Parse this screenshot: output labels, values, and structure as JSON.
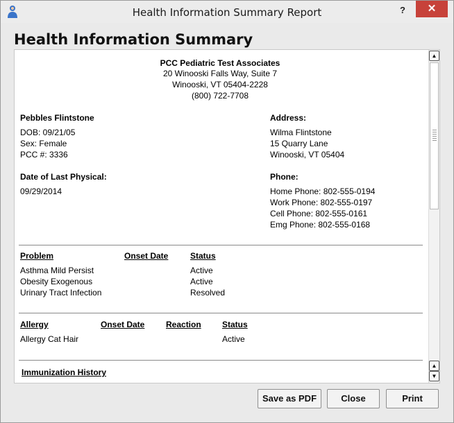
{
  "window": {
    "title": "Health Information Summary Report",
    "help_label": "?",
    "close_label": "✕"
  },
  "heading": "Health Information Summary",
  "practice": {
    "name": "PCC Pediatric Test Associates",
    "address1": "20 Winooski Falls Way, Suite 7",
    "address2": "Winooski, VT 05404-2228",
    "phone": "(800) 722-7708"
  },
  "patient": {
    "name": "Pebbles Flintstone",
    "dob": "DOB: 09/21/05",
    "sex": "Sex: Female",
    "pcc": "PCC #: 3336",
    "last_physical_label": "Date of Last Physical:",
    "last_physical": "09/29/2014"
  },
  "address": {
    "label": "Address:",
    "line1": "Wilma Flintstone",
    "line2": "15 Quarry Lane",
    "line3": "Winooski, VT 05404"
  },
  "phone": {
    "label": "Phone:",
    "home": "Home Phone: 802-555-0194",
    "work": "Work Phone: 802-555-0197",
    "cell": "Cell Phone: 802-555-0161",
    "emg": "Emg Phone: 802-555-0168"
  },
  "problems": {
    "headers": {
      "problem": "Problem",
      "onset": "Onset Date",
      "status": "Status"
    },
    "rows": [
      {
        "problem": "Asthma Mild Persist",
        "onset": "",
        "status": "Active"
      },
      {
        "problem": "Obesity Exogenous",
        "onset": "",
        "status": "Active"
      },
      {
        "problem": "Urinary Tract Infection",
        "onset": "",
        "status": "Resolved"
      }
    ]
  },
  "allergies": {
    "headers": {
      "allergy": "Allergy",
      "onset": "Onset Date",
      "reaction": "Reaction",
      "status": "Status"
    },
    "rows": [
      {
        "allergy": "Allergy Cat Hair",
        "onset": "",
        "reaction": "",
        "status": "Active"
      }
    ]
  },
  "immunization": {
    "header": "Immunization History"
  },
  "scrollbar": {
    "up": "▲",
    "down": "▼"
  },
  "buttons": {
    "save_pdf": "Save as PDF",
    "close": "Close",
    "print": "Print"
  }
}
